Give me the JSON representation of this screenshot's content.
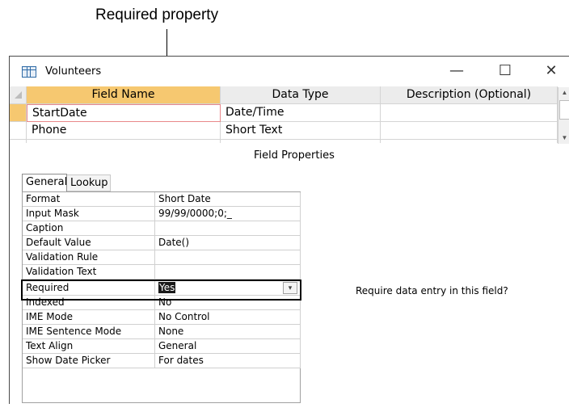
{
  "callout": {
    "label": "Required property"
  },
  "window": {
    "title": "Volunteers",
    "minimize_glyph": "—",
    "maximize_glyph": "☐",
    "close_glyph": "✕"
  },
  "grid": {
    "columns": [
      "Field Name",
      "Data Type",
      "Description (Optional)"
    ],
    "rows": [
      {
        "field_name": "StartDate",
        "data_type": "Date/Time",
        "description": ""
      },
      {
        "field_name": "Phone",
        "data_type": "Short Text",
        "description": ""
      }
    ],
    "scroll_up_glyph": "▲",
    "scroll_down_glyph": "▼"
  },
  "field_properties": {
    "title": "Field Properties",
    "tabs": [
      "General",
      "Lookup"
    ],
    "active_tab": "General",
    "properties": [
      {
        "name": "Format",
        "value": "Short Date"
      },
      {
        "name": "Input Mask",
        "value": "99/99/0000;0;_"
      },
      {
        "name": "Caption",
        "value": ""
      },
      {
        "name": "Default Value",
        "value": "Date()"
      },
      {
        "name": "Validation Rule",
        "value": ""
      },
      {
        "name": "Validation Text",
        "value": ""
      },
      {
        "name": "Required",
        "value": "Yes"
      },
      {
        "name": "Indexed",
        "value": "No"
      },
      {
        "name": "IME Mode",
        "value": "No Control"
      },
      {
        "name": "IME Sentence Mode",
        "value": "None"
      },
      {
        "name": "Text Align",
        "value": "General"
      },
      {
        "name": "Show Date Picker",
        "value": "For dates"
      }
    ],
    "dropdown_glyph": "▾",
    "help_text": "Require data entry in this field?"
  },
  "colors": {
    "header_selected": "#f6c870",
    "active_cell_border": "#e8888a",
    "highlight_box": "#000000"
  }
}
